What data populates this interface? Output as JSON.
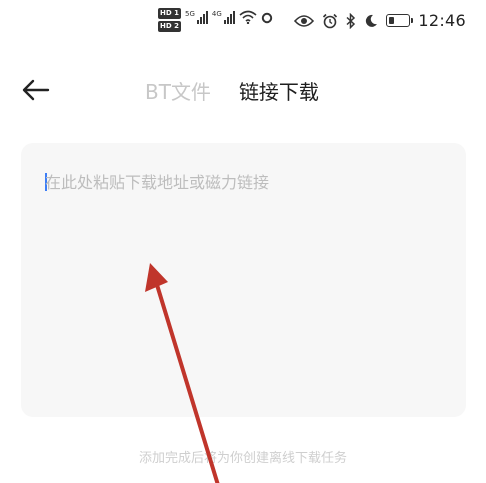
{
  "status_bar": {
    "sim1_badge": "HD 1",
    "sim2_badge": "HD 2",
    "net1_label": "5G",
    "net2_label": "4G",
    "time": "12:46",
    "battery_level": 0.3
  },
  "header": {
    "tab_bt": "BT文件",
    "tab_link": "链接下载",
    "active_tab": "链接下载"
  },
  "link_input": {
    "placeholder": "在此处粘贴下载地址或磁力链接",
    "value": ""
  },
  "hint": "添加完成后将为你创建离线下载任务",
  "colors": {
    "accent": "#3d7ef6",
    "annotation_arrow": "#c0352b"
  }
}
